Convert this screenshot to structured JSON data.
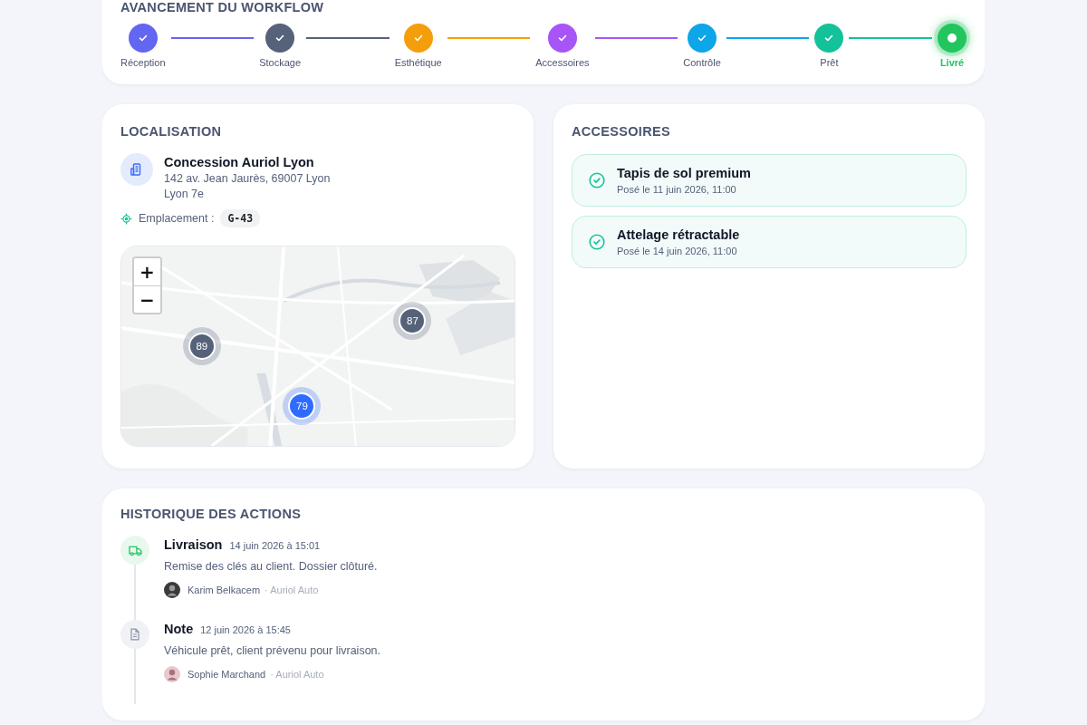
{
  "workflow": {
    "title": "AVANCEMENT DU WORKFLOW",
    "steps": [
      {
        "label": "Réception",
        "kind": "done",
        "color": "#6366f1"
      },
      {
        "label": "Stockage",
        "kind": "done",
        "color": "#55627a"
      },
      {
        "label": "Esthétique",
        "kind": "done",
        "color": "#f59e0b"
      },
      {
        "label": "Accessoires",
        "kind": "done",
        "color": "#a855f7"
      },
      {
        "label": "Contrôle",
        "kind": "done",
        "color": "#0ea5e9"
      },
      {
        "label": "Prêt",
        "kind": "done",
        "color": "#14c29a"
      },
      {
        "label": "Livré",
        "kind": "current",
        "color": "#22c55e"
      }
    ]
  },
  "location": {
    "title": "LOCALISATION",
    "name": "Concession Auriol Lyon",
    "address": "142 av. Jean Jaurès, 69007 Lyon",
    "district": "Lyon 7e",
    "slot_label": "Emplacement :",
    "slot": "G-43",
    "map": {
      "zoom_in": "+",
      "zoom_out": "−",
      "markers": [
        {
          "count": "89",
          "color": "#55627a"
        },
        {
          "count": "87",
          "color": "#55627a"
        },
        {
          "count": "79",
          "color": "#2f6bff"
        }
      ]
    }
  },
  "accessories": {
    "title": "ACCESSOIRES",
    "items": [
      {
        "name": "Tapis de sol premium",
        "date": "Posé le 11 juin 2026, 11:00"
      },
      {
        "name": "Attelage rétractable",
        "date": "Posé le 14 juin 2026, 11:00"
      }
    ]
  },
  "history": {
    "title": "HISTORIQUE DES ACTIONS",
    "items": [
      {
        "kind": "delivery",
        "title": "Livraison",
        "date": "14 juin 2026 à 15:01",
        "text": "Remise des clés au client. Dossier clôturé.",
        "author": "Karim Belkacem",
        "company": "· Auriol Auto"
      },
      {
        "kind": "note",
        "title": "Note",
        "date": "12 juin 2026 à 15:45",
        "text": "Véhicule prêt, client prévenu pour livraison.",
        "author": "Sophie Marchand",
        "company": "· Auriol Auto"
      }
    ]
  }
}
